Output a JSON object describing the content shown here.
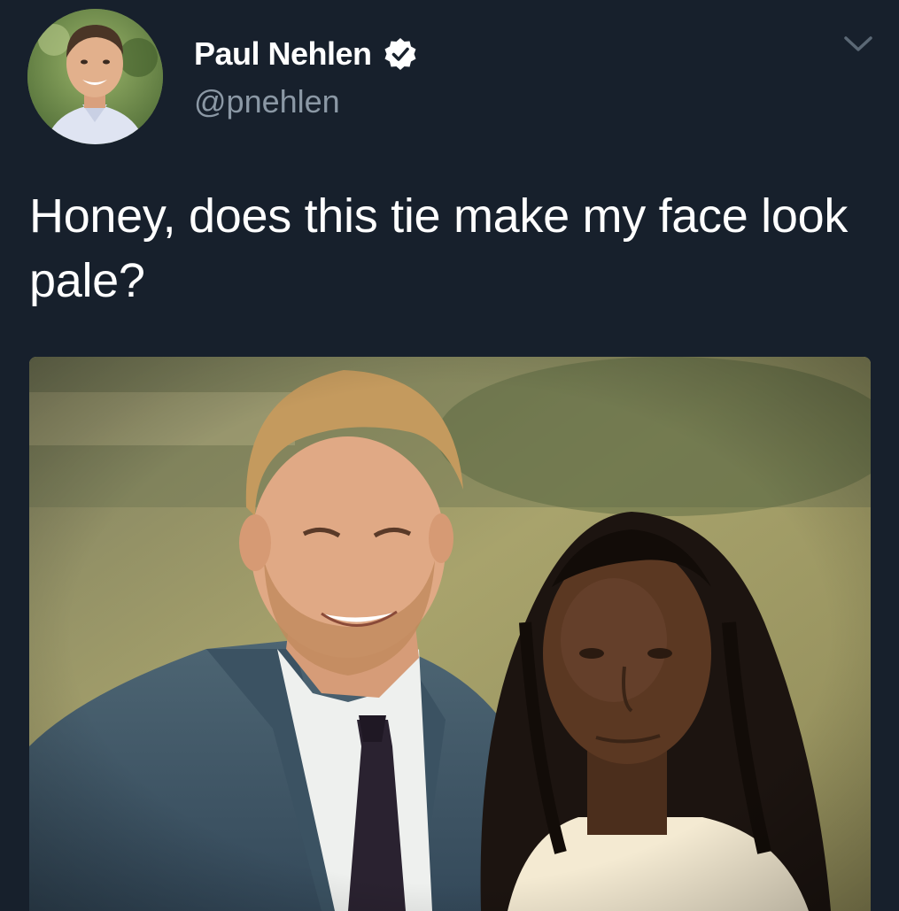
{
  "user": {
    "display_name": "Paul Nehlen",
    "handle": "@pnehlen",
    "verified": true,
    "avatar_icon": "profile-photo"
  },
  "tweet": {
    "text": "Honey, does this tie make my face look pale?"
  },
  "menu": {
    "icon": "chevron-down-icon"
  },
  "media": {
    "type": "photo"
  },
  "colors": {
    "background": "#17202c",
    "text_primary": "#ffffff",
    "text_secondary": "#8b98a5",
    "verified_badge": "#ffffff"
  }
}
